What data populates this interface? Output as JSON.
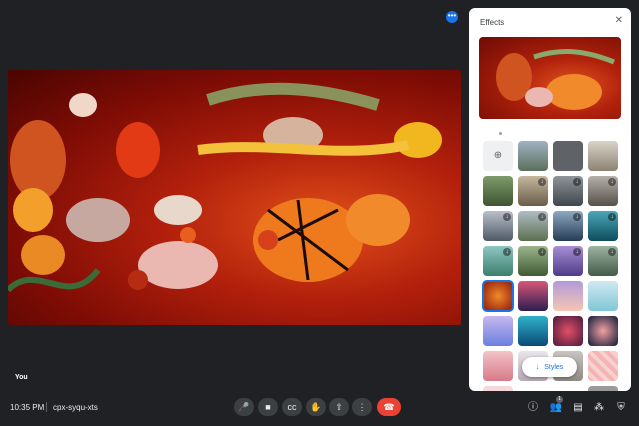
{
  "stage": {
    "self_label": "You"
  },
  "effects_panel": {
    "title": "Effects",
    "close_icon": "close-icon",
    "upload_icon": "add-image-icon",
    "styles_label": "Styles",
    "styles_icon": "arrow-down-icon"
  },
  "bottom_bar": {
    "time": "10:35 PM",
    "meeting_code": "cpx-syqu-xts",
    "participants_count": "1"
  },
  "colors": {
    "accent": "#1a73e8",
    "hangup": "#ea4335",
    "background": "#202124",
    "control": "#3c4043"
  }
}
